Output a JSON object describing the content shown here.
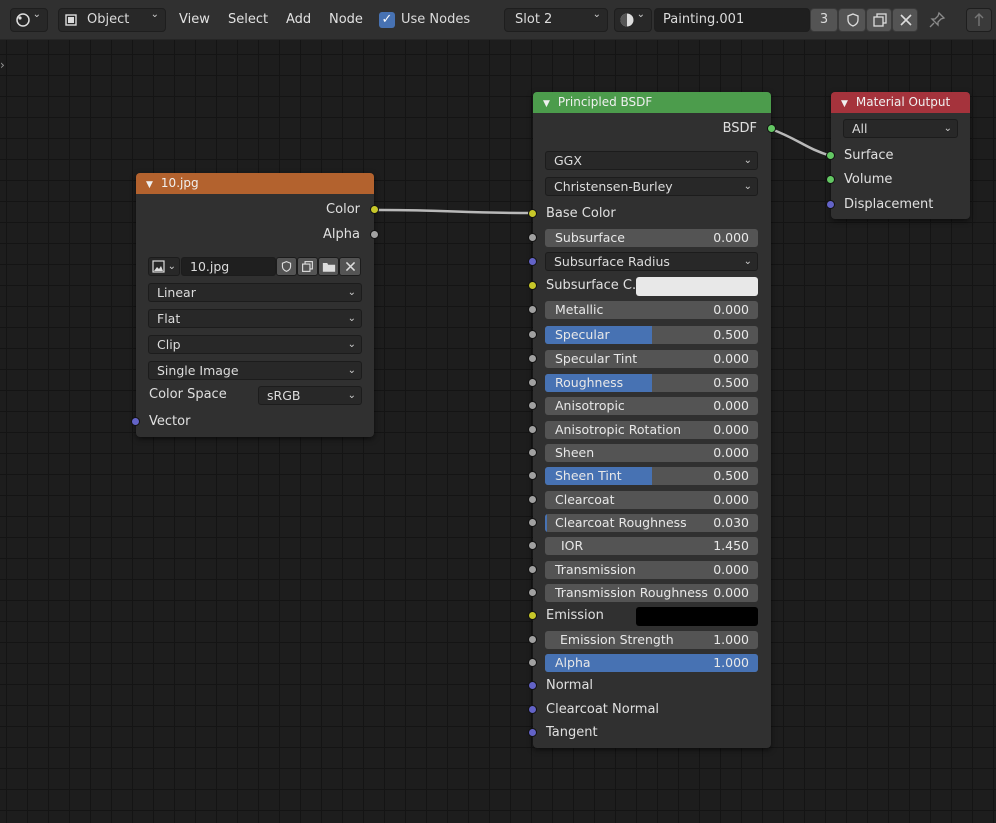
{
  "header": {
    "mode": "Object",
    "menus": [
      "View",
      "Select",
      "Add",
      "Node"
    ],
    "use_nodes_label": "Use Nodes",
    "use_nodes_checked": true,
    "slot": "Slot 2",
    "material_name": "Painting.001",
    "user_count": "3"
  },
  "image_node": {
    "title": "10.jpg",
    "header_color": "#b3622e",
    "outputs": [
      "Color",
      "Alpha"
    ],
    "image_name": "10.jpg",
    "interpolation": "Linear",
    "projection": "Flat",
    "extension": "Clip",
    "source": "Single Image",
    "color_space_label": "Color Space",
    "color_space": "sRGB",
    "input": "Vector"
  },
  "bsdf_node": {
    "title": "Principled BSDF",
    "header_color": "#4c9c4c",
    "output": "BSDF",
    "distribution": "GGX",
    "subsurface_method": "Christensen-Burley",
    "base_color_label": "Base Color",
    "subsurface_radius_label": "Subsurface Radius",
    "subsurface_color_label": "Subsurface C...",
    "emission_label": "Emission",
    "normal_label": "Normal",
    "clearcoat_normal_label": "Clearcoat Normal",
    "tangent_label": "Tangent",
    "params": [
      {
        "name": "Subsurface",
        "value": "0.000",
        "fraction": 0
      },
      {
        "name": "Metallic",
        "value": "0.000",
        "fraction": 0
      },
      {
        "name": "Specular",
        "value": "0.500",
        "fraction": 0.5
      },
      {
        "name": "Specular Tint",
        "value": "0.000",
        "fraction": 0
      },
      {
        "name": "Roughness",
        "value": "0.500",
        "fraction": 0.5
      },
      {
        "name": "Anisotropic",
        "value": "0.000",
        "fraction": 0
      },
      {
        "name": "Anisotropic Rotation",
        "value": "0.000",
        "fraction": 0
      },
      {
        "name": "Sheen",
        "value": "0.000",
        "fraction": 0
      },
      {
        "name": "Sheen Tint",
        "value": "0.500",
        "fraction": 0.5
      },
      {
        "name": "Clearcoat",
        "value": "0.000",
        "fraction": 0
      },
      {
        "name": "Clearcoat Roughness",
        "value": "0.030",
        "fraction": 0.03
      },
      {
        "name": "IOR",
        "value": "1.450",
        "fraction": 0
      },
      {
        "name": "Transmission",
        "value": "0.000",
        "fraction": 0
      },
      {
        "name": "Transmission Roughness",
        "value": "0.000",
        "fraction": 0
      },
      {
        "name": "Emission Strength",
        "value": "1.000",
        "fraction": 0
      },
      {
        "name": "Alpha",
        "value": "1.000",
        "fraction": 1
      }
    ]
  },
  "output_node": {
    "title": "Material Output",
    "header_color": "#a5333c",
    "target": "All",
    "inputs": [
      "Surface",
      "Volume",
      "Displacement"
    ]
  },
  "socket_colors": {
    "color": "#c7c729",
    "float": "#a1a1a1",
    "vector": "#6363c7",
    "shader": "#63c763"
  }
}
